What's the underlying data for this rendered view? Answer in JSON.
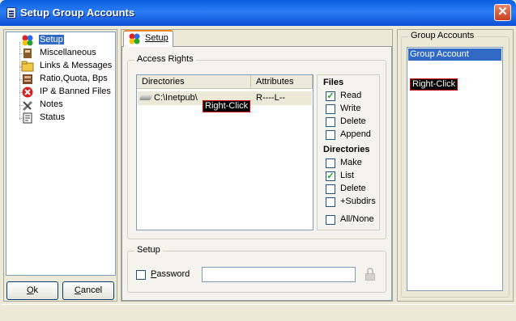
{
  "window": {
    "title": "Setup Group Accounts"
  },
  "tree": {
    "items": [
      {
        "label": "Setup",
        "icon": "setup-icon",
        "selected": true
      },
      {
        "label": "Miscellaneous",
        "icon": "book-icon"
      },
      {
        "label": "Links & Messages",
        "icon": "folder-icon"
      },
      {
        "label": "Ratio,Quota, Bps",
        "icon": "ratio-icon"
      },
      {
        "label": "IP & Banned Files",
        "icon": "banned-icon"
      },
      {
        "label": "Notes",
        "icon": "notes-icon"
      },
      {
        "label": "Status",
        "icon": "status-icon"
      }
    ]
  },
  "buttons": {
    "ok_accel": "O",
    "ok_rest": "k",
    "cancel_accel": "C",
    "cancel_rest": "ancel"
  },
  "tab": {
    "label": "Setup"
  },
  "access_rights": {
    "legend": "Access Rights",
    "columns": {
      "directories": "Directories",
      "attributes": "Attributes"
    },
    "rows": [
      {
        "directory": "C:\\Inetpub\\",
        "attributes": "R----L--"
      }
    ],
    "right_click_hint": "Right-Click"
  },
  "files": {
    "heading": "Files",
    "options": [
      {
        "label": "Read",
        "checked": true
      },
      {
        "label": "Write",
        "checked": false
      },
      {
        "label": "Delete",
        "checked": false
      },
      {
        "label": "Append",
        "checked": false
      }
    ]
  },
  "directories": {
    "heading": "Directories",
    "options": [
      {
        "label": "Make",
        "checked": false
      },
      {
        "label": "List",
        "checked": true
      },
      {
        "label": "Delete",
        "checked": false
      },
      {
        "label": "+Subdirs",
        "checked": false
      }
    ],
    "all_none": {
      "label": "All/None",
      "checked": false
    }
  },
  "setup": {
    "legend": "Setup",
    "password_label": "Password",
    "password_accel": "P",
    "password_rest": "assword",
    "password_value": ""
  },
  "group_accounts": {
    "legend": "Group Accounts",
    "items": [
      {
        "label": "Group Account",
        "selected": true
      }
    ],
    "right_click_hint": "Right-Click"
  },
  "colors": {
    "titlebar": "#0a5fe0",
    "selection": "#316ac5",
    "tab_highlight": "#e68b2c",
    "checkmark": "#21a121"
  }
}
